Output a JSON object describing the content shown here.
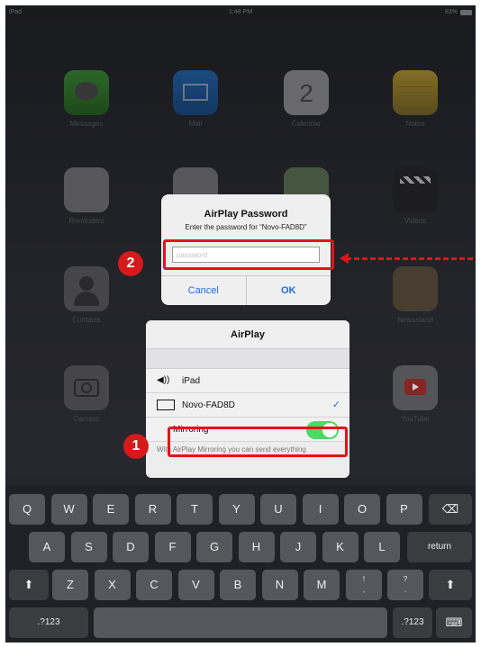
{
  "status_bar": {
    "device": "iPad",
    "time": "1:48 PM",
    "battery": "83%"
  },
  "home_apps": [
    {
      "label": "Messages"
    },
    {
      "label": "Mail"
    },
    {
      "label": "Calendar",
      "day": "2"
    },
    {
      "label": "Notes"
    },
    {
      "label": "Reminders"
    },
    {
      "label": ""
    },
    {
      "label": ""
    },
    {
      "label": "Videos"
    },
    {
      "label": "Contacts"
    },
    {
      "label": ""
    },
    {
      "label": ""
    },
    {
      "label": "Newsstand"
    },
    {
      "label": "Camera"
    },
    {
      "label": "YouTube"
    }
  ],
  "dialog": {
    "title": "AirPlay Password",
    "message": "Enter the password for “Novo-FAD8D”",
    "password_placeholder": "password",
    "cancel_label": "Cancel",
    "ok_label": "OK"
  },
  "airplay": {
    "title": "AirPlay",
    "devices": [
      {
        "name": "iPad",
        "icon": "speaker-icon",
        "selected": false
      },
      {
        "name": "Novo-FAD8D",
        "icon": "tv-icon",
        "selected": true
      }
    ],
    "mirroring_label": "Mirroring",
    "mirroring_on": true,
    "footer": "With AirPlay Mirroring you can send everything"
  },
  "annotations": {
    "marker_1": "1",
    "marker_2": "2"
  },
  "keyboard": {
    "row1": [
      "Q",
      "W",
      "E",
      "R",
      "T",
      "Y",
      "U",
      "I",
      "O",
      "P"
    ],
    "row2": [
      "A",
      "S",
      "D",
      "F",
      "G",
      "H",
      "J",
      "K",
      "L"
    ],
    "row3": [
      "Z",
      "X",
      "C",
      "V",
      "B",
      "N",
      "M"
    ],
    "row3_punct": [
      "!\n,",
      "?\n."
    ],
    "return_label": "return",
    "numbers_label": ".?123"
  },
  "colors": {
    "accent": "#1a6cf0",
    "toggle_on": "#4cd964",
    "annotation": "#e0141c"
  }
}
